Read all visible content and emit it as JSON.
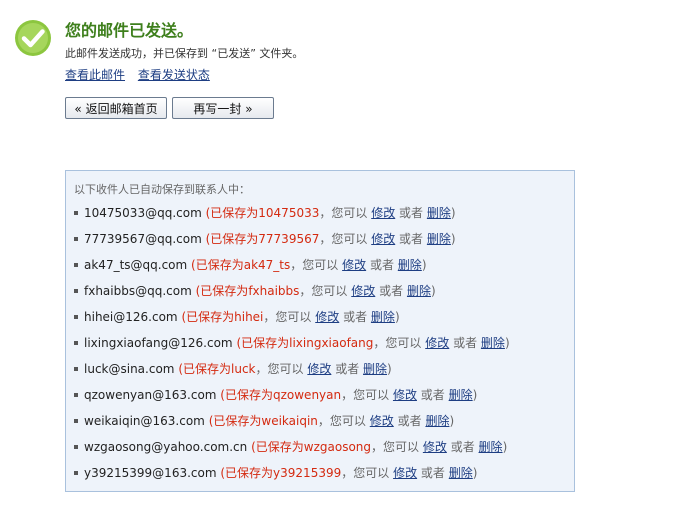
{
  "header": {
    "title": "您的邮件已发送。",
    "subtitle": "此邮件发送成功，并已保存到 “已发送” 文件夹。",
    "view_mail_link": "查看此邮件",
    "view_status_link": "查看发送状态"
  },
  "buttons": {
    "back_label": "« 返回邮箱首页",
    "rewrite_label": "再写一封 »"
  },
  "contacts": {
    "header": "以下收件人已自动保存到联系人中：",
    "saved_prefix": "(已保存为",
    "you_can": "，您可以",
    "edit_label": "修改",
    "or_label": "或者",
    "delete_label": "删除",
    "close_paren": ")",
    "items": [
      {
        "email": "10475033@qq.com",
        "saved_name": "10475033"
      },
      {
        "email": "77739567@qq.com",
        "saved_name": "77739567"
      },
      {
        "email": "ak47_ts@qq.com",
        "saved_name": "ak47_ts"
      },
      {
        "email": "fxhaibbs@qq.com",
        "saved_name": "fxhaibbs"
      },
      {
        "email": "hihei@126.com",
        "saved_name": "hihei"
      },
      {
        "email": "lixingxiaofang@126.com",
        "saved_name": "lixingxiaofang"
      },
      {
        "email": "luck@sina.com",
        "saved_name": "luck"
      },
      {
        "email": "qzowenyan@163.com",
        "saved_name": "qzowenyan"
      },
      {
        "email": "weikaiqin@163.com",
        "saved_name": "weikaiqin"
      },
      {
        "email": "wzgaosong@yahoo.com.cn",
        "saved_name": "wzgaosong"
      },
      {
        "email": "y39215399@163.com",
        "saved_name": "y39215399"
      }
    ]
  },
  "colors": {
    "title_green": "#3e7f1c",
    "icon_green": "#8cc63f",
    "saved_red": "#d42a10",
    "link_blue": "#1e3e83",
    "box_border": "#a9c1dd",
    "box_background": "#eef3fa"
  },
  "icons": {
    "success": "check-circle-icon"
  }
}
